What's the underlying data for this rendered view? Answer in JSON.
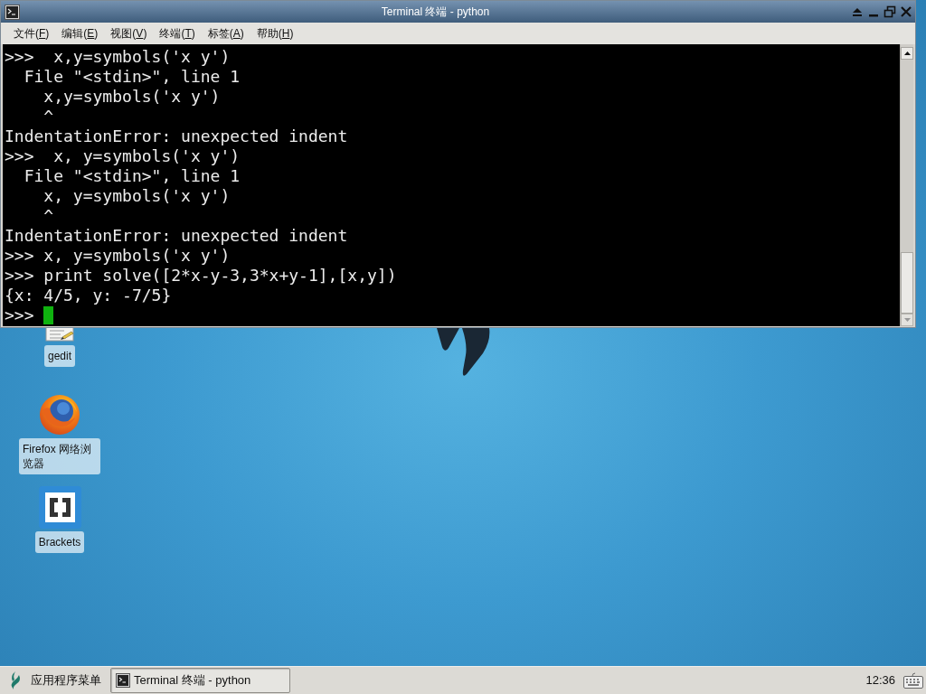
{
  "window": {
    "title": "Terminal 终端 - python"
  },
  "menu": [
    {
      "text": "文件(",
      "access_key": "F",
      "text_end": ")"
    },
    {
      "text": "编辑(",
      "access_key": "E",
      "text_end": ")"
    },
    {
      "text": "视图(",
      "access_key": "V",
      "text_end": ")"
    },
    {
      "text": "终端(",
      "access_key": "T",
      "text_end": ")"
    },
    {
      "text": "标签(",
      "access_key": "A",
      "text_end": ")"
    },
    {
      "text": "帮助(",
      "access_key": "H",
      "text_end": ")"
    }
  ],
  "terminal": {
    "lines": [
      ">>>  x,y=symbols('x y')",
      "  File \"<stdin>\", line 1",
      "    x,y=symbols('x y')",
      "    ^",
      "IndentationError: unexpected indent",
      ">>>  x, y=symbols('x y')",
      "  File \"<stdin>\", line 1",
      "    x, y=symbols('x y')",
      "    ^",
      "IndentationError: unexpected indent",
      ">>> x, y=symbols('x y')",
      ">>> print solve([2*x-y-3,3*x+y-1],[x,y])",
      "{x: 4/5, y: -7/5}"
    ],
    "prompt": ">>> ",
    "cursor": true
  },
  "desktop_icons": [
    {
      "kind": "editor",
      "label": "gedit"
    },
    {
      "kind": "browser",
      "label": "Firefox 网络浏览器"
    },
    {
      "kind": "brackets",
      "label": "Brackets"
    }
  ],
  "taskbar": {
    "menu_button": "应用程序菜单",
    "tasks": [
      {
        "label": "Terminal 终端 - python",
        "selected": true
      }
    ],
    "clock": "12:36"
  }
}
